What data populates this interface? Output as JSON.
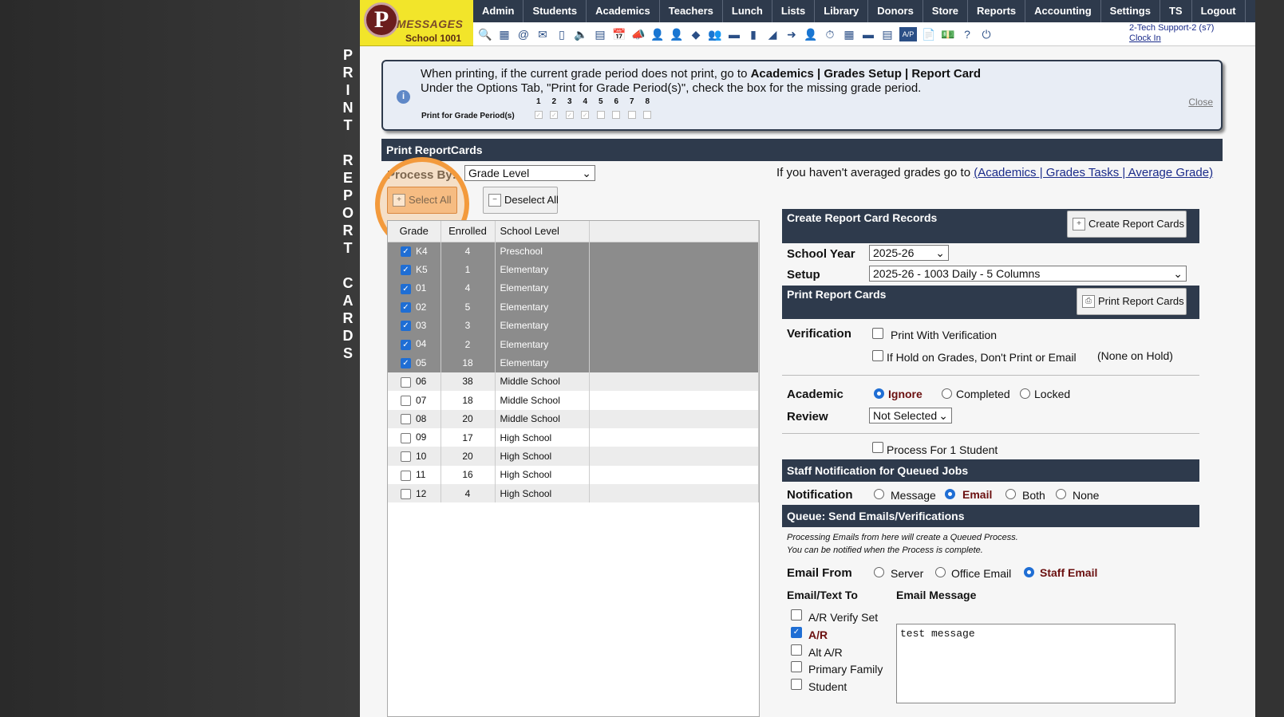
{
  "side_title": [
    "P",
    "R",
    "I",
    "N",
    "T",
    "",
    "R",
    "E",
    "P",
    "O",
    "R",
    "T",
    "",
    "C",
    "A",
    "R",
    "D",
    "S"
  ],
  "logo": {
    "letter": "P",
    "word": "MESSAGES",
    "school": "School 1001"
  },
  "topnav": [
    "Admin",
    "Students",
    "Academics",
    "Teachers",
    "Lunch",
    "Lists",
    "Library",
    "Donors",
    "Store",
    "Reports",
    "Accounting",
    "Settings",
    "TS",
    "Logout"
  ],
  "toolbar_icons": [
    "🔍",
    "▦",
    "@",
    "✉",
    "▯",
    "🔈",
    "▤",
    "📅",
    "📣",
    "👤",
    "👤",
    "◆",
    "👥",
    "▬",
    "▮",
    "◢",
    "➜",
    "👤",
    "⏱",
    "▦",
    "▬",
    "▤",
    "A/P",
    "📄",
    "💵",
    "?",
    "⏻"
  ],
  "user": {
    "name": "2-Tech Support-2 (s7)",
    "clock": "Clock In"
  },
  "info": {
    "line1_pre": "When printing, if the current grade period does not print, go to ",
    "line1_bold": "Academics | Grades Setup | Report Card",
    "line2": "Under the Options Tab, \"Print for Grade Period(s)\", check the box for the missing grade period.",
    "periods": [
      "1",
      "2",
      "3",
      "4",
      "5",
      "6",
      "7",
      "8"
    ],
    "period_label": "Print for Grade Period(s)",
    "close": "Close"
  },
  "section_title": "Print ReportCards",
  "process": {
    "label": "Process By:",
    "value": "Grade Level",
    "avg_text": "If you haven't averaged grades go to ",
    "avg_link": "(Academics | Grades Tasks | Average Grade)"
  },
  "buttons": {
    "select_all": "Select All",
    "deselect_all": "Deselect All"
  },
  "grade_table": {
    "headers": [
      "Grade",
      "Enrolled",
      "School Level"
    ],
    "rows": [
      {
        "grade": "K4",
        "enrolled": "4",
        "level": "Preschool",
        "checked": true
      },
      {
        "grade": "K5",
        "enrolled": "1",
        "level": "Elementary",
        "checked": true
      },
      {
        "grade": "01",
        "enrolled": "4",
        "level": "Elementary",
        "checked": true
      },
      {
        "grade": "02",
        "enrolled": "5",
        "level": "Elementary",
        "checked": true
      },
      {
        "grade": "03",
        "enrolled": "3",
        "level": "Elementary",
        "checked": true
      },
      {
        "grade": "04",
        "enrolled": "2",
        "level": "Elementary",
        "checked": true
      },
      {
        "grade": "05",
        "enrolled": "18",
        "level": "Elementary",
        "checked": true
      },
      {
        "grade": "06",
        "enrolled": "38",
        "level": "Middle School",
        "checked": false
      },
      {
        "grade": "07",
        "enrolled": "18",
        "level": "Middle School",
        "checked": false
      },
      {
        "grade": "08",
        "enrolled": "20",
        "level": "Middle School",
        "checked": false
      },
      {
        "grade": "09",
        "enrolled": "17",
        "level": "High School",
        "checked": false
      },
      {
        "grade": "10",
        "enrolled": "20",
        "level": "High School",
        "checked": false
      },
      {
        "grade": "11",
        "enrolled": "16",
        "level": "High School",
        "checked": false
      },
      {
        "grade": "12",
        "enrolled": "4",
        "level": "High School",
        "checked": false
      }
    ]
  },
  "right": {
    "create_title": "Create Report Card Records",
    "create_btn": "Create Report Cards",
    "school_year_label": "School Year",
    "school_year": "2025-26",
    "setup_label": "Setup",
    "setup": "2025-26 - 1003 Daily - 5 Columns",
    "print_title": "Print Report Cards",
    "print_btn": "Print Report Cards",
    "verification_label": "Verification",
    "print_with_verification": "Print With Verification",
    "hold_text": "If Hold on Grades, Don't Print or Email",
    "none_on_hold": "(None on Hold)",
    "academic_label": "Academic",
    "review_label": "Review",
    "academic_options": [
      "Ignore",
      "Completed",
      "Locked"
    ],
    "review_value": "Not Selected",
    "process_one": "Process For 1 Student",
    "staff_title": "Staff Notification for Queued Jobs",
    "notification_label": "Notification",
    "notification_options": [
      "Message",
      "Email",
      "Both",
      "None"
    ],
    "queue_title": "Queue: Send Emails/Verifications",
    "queue_note1": "Processing Emails from here will create a Queued Process.",
    "queue_note2": "You can be notified when the Process is complete.",
    "email_from_label": "Email From",
    "email_from_options": [
      "Server",
      "Office Email",
      "Staff Email"
    ],
    "email_to_label": "Email/Text To",
    "email_msg_label": "Email Message",
    "email_to_options": [
      "A/R Verify Set",
      "A/R",
      "Alt A/R",
      "Primary Family",
      "Student"
    ],
    "email_message": "test message"
  }
}
